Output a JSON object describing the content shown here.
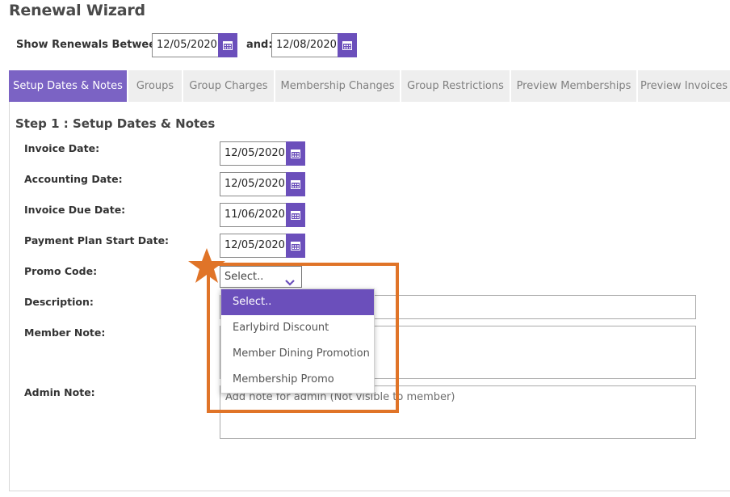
{
  "page": {
    "title": "Renewal Wizard"
  },
  "date_range": {
    "from_label": "Show Renewals Between:",
    "from_value": "12/05/2020",
    "to_label": "and:",
    "to_value": "12/08/2020"
  },
  "tabs": [
    {
      "label": "Setup Dates & Notes"
    },
    {
      "label": "Groups"
    },
    {
      "label": "Group Charges"
    },
    {
      "label": "Membership Changes"
    },
    {
      "label": "Group Restrictions"
    },
    {
      "label": "Preview Memberships"
    },
    {
      "label": "Preview Invoices"
    }
  ],
  "step": {
    "title": "Step 1 : Setup Dates & Notes"
  },
  "fields": {
    "invoice_date": {
      "label": "Invoice Date:",
      "value": "12/05/2020"
    },
    "accounting_date": {
      "label": "Accounting Date:",
      "value": "12/05/2020"
    },
    "invoice_due_date": {
      "label": "Invoice Due Date:",
      "value": "11/06/2020"
    },
    "payment_plan_start_date": {
      "label": "Payment Plan Start Date:",
      "value": "12/05/2020"
    },
    "promo_code": {
      "label": "Promo Code:",
      "value": "Select.."
    },
    "description": {
      "label": "Description:"
    },
    "member_note": {
      "label": "Member Note:"
    },
    "admin_note": {
      "label": "Admin Note:",
      "placeholder": "Add note for admin (Not visible to member)"
    }
  },
  "promo_dropdown": {
    "options": [
      "Select..",
      "Earlybird Discount",
      "Member Dining Promotion",
      "Membership Promo"
    ]
  },
  "colors": {
    "accent": "#6b4fbb",
    "active_tab": "#7b63c4",
    "callout": "#e07428"
  }
}
